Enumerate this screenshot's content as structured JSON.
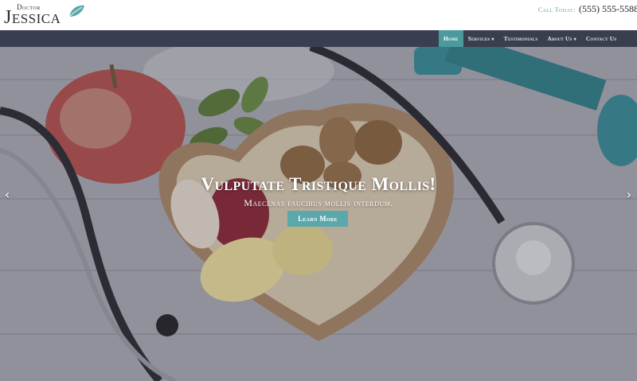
{
  "logo": {
    "small": "Doctor",
    "big": "Jessica"
  },
  "contact": {
    "label": "Call Today:",
    "phone": "(555) 555-5588"
  },
  "nav": {
    "items": [
      {
        "label": "Home",
        "active": true,
        "dropdown": false
      },
      {
        "label": "Services",
        "active": false,
        "dropdown": true
      },
      {
        "label": "Testimonials",
        "active": false,
        "dropdown": false
      },
      {
        "label": "About Us",
        "active": false,
        "dropdown": true
      },
      {
        "label": "Contact Us",
        "active": false,
        "dropdown": false
      }
    ],
    "caret": "▾"
  },
  "hero": {
    "title": "Vulputate Tristique Mollis!",
    "subtitle": "Maecenas faucibus mollis interdum.",
    "button": "Learn More",
    "prev_icon": "‹",
    "next_icon": "›"
  },
  "colors": {
    "accent": "#4a9a9e",
    "nav_bg": "#3a3f50",
    "button": "#5aa8ab"
  }
}
